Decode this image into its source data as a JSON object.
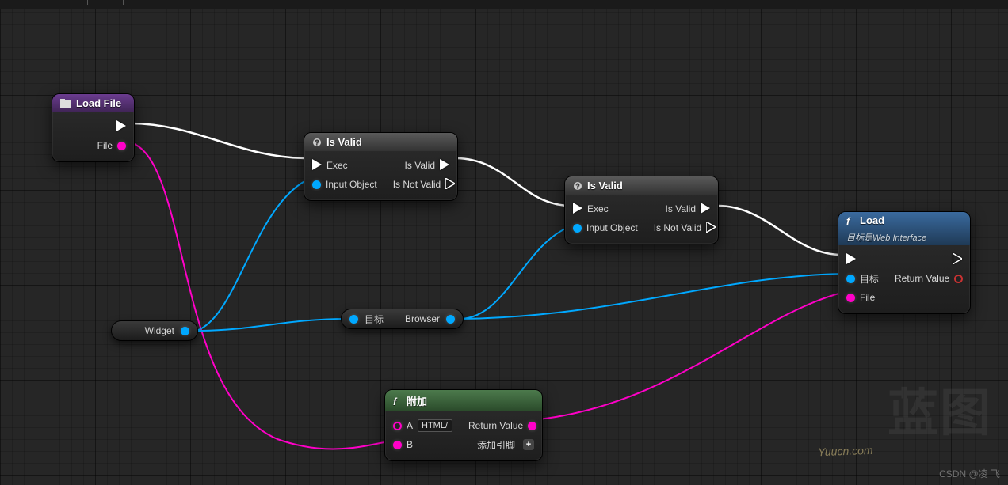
{
  "nodes": {
    "loadFile": {
      "title": "Load File",
      "pins": {
        "file": "File"
      }
    },
    "isValid1": {
      "title": "Is Valid",
      "pins": {
        "exec": "Exec",
        "inputObject": "Input Object",
        "isValid": "Is Valid",
        "isNotValid": "Is Not Valid"
      }
    },
    "isValid2": {
      "title": "Is Valid",
      "pins": {
        "exec": "Exec",
        "inputObject": "Input Object",
        "isValid": "Is Valid",
        "isNotValid": "Is Not Valid"
      }
    },
    "load": {
      "title": "Load",
      "subtitle": "目标是Web Interface",
      "pins": {
        "target": "目标",
        "file": "File",
        "returnValue": "Return Value"
      }
    },
    "append": {
      "title": "附加",
      "pins": {
        "a": "A",
        "aValue": "HTML/",
        "b": "B",
        "returnValue": "Return Value",
        "addPin": "添加引脚"
      }
    }
  },
  "reroutes": {
    "widget": {
      "left": "",
      "label": "Widget"
    },
    "browser": {
      "left": "目标",
      "right": "Browser"
    }
  },
  "watermarks": {
    "bg": "蓝图",
    "url": "Yuucn.com",
    "csdn": "CSDN @凌 飞"
  }
}
